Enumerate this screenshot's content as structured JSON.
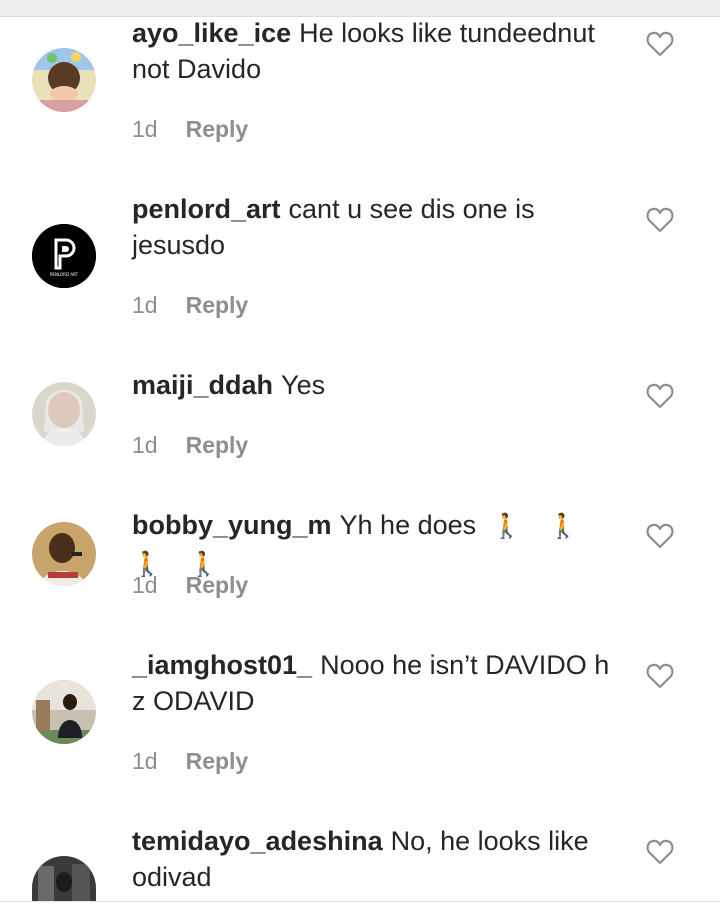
{
  "comments": [
    {
      "username": "ayo_like_ice",
      "text": "He looks like tundeednut not Davido",
      "time": "1d",
      "reply_label": "Reply",
      "avatar_icon": "avatar-photo"
    },
    {
      "username": "penlord_art",
      "text": "cant u see dis one is jesusdo",
      "time": "1d",
      "reply_label": "Reply",
      "avatar_icon": "penlord-logo",
      "avatar_caption": "PENLORD ART"
    },
    {
      "username": "maiji_ddah",
      "text": "Yes",
      "time": "1d",
      "reply_label": "Reply",
      "avatar_icon": "avatar-photo"
    },
    {
      "username": "bobby_yung_m",
      "text": "Yh he does",
      "emoji": "🚶 🚶 🚶 🚶",
      "time": "1d",
      "reply_label": "Reply",
      "avatar_icon": "avatar-photo"
    },
    {
      "username": "_iamghost01_",
      "text": "Nooo he isn’t DAVIDO h z ODAVID",
      "time": "1d",
      "reply_label": "Reply",
      "avatar_icon": "avatar-photo"
    },
    {
      "username": "temidayo_adeshina",
      "text": "No, he looks like odivad",
      "avatar_icon": "avatar-photo"
    }
  ],
  "colors": {
    "text": "#262626",
    "secondary": "#8e8e8e",
    "heart_outline": "#8e8e8e",
    "background": "#ffffff"
  },
  "icons": {
    "like": "heart-outline-icon",
    "walking": "person-walking-emoji"
  }
}
